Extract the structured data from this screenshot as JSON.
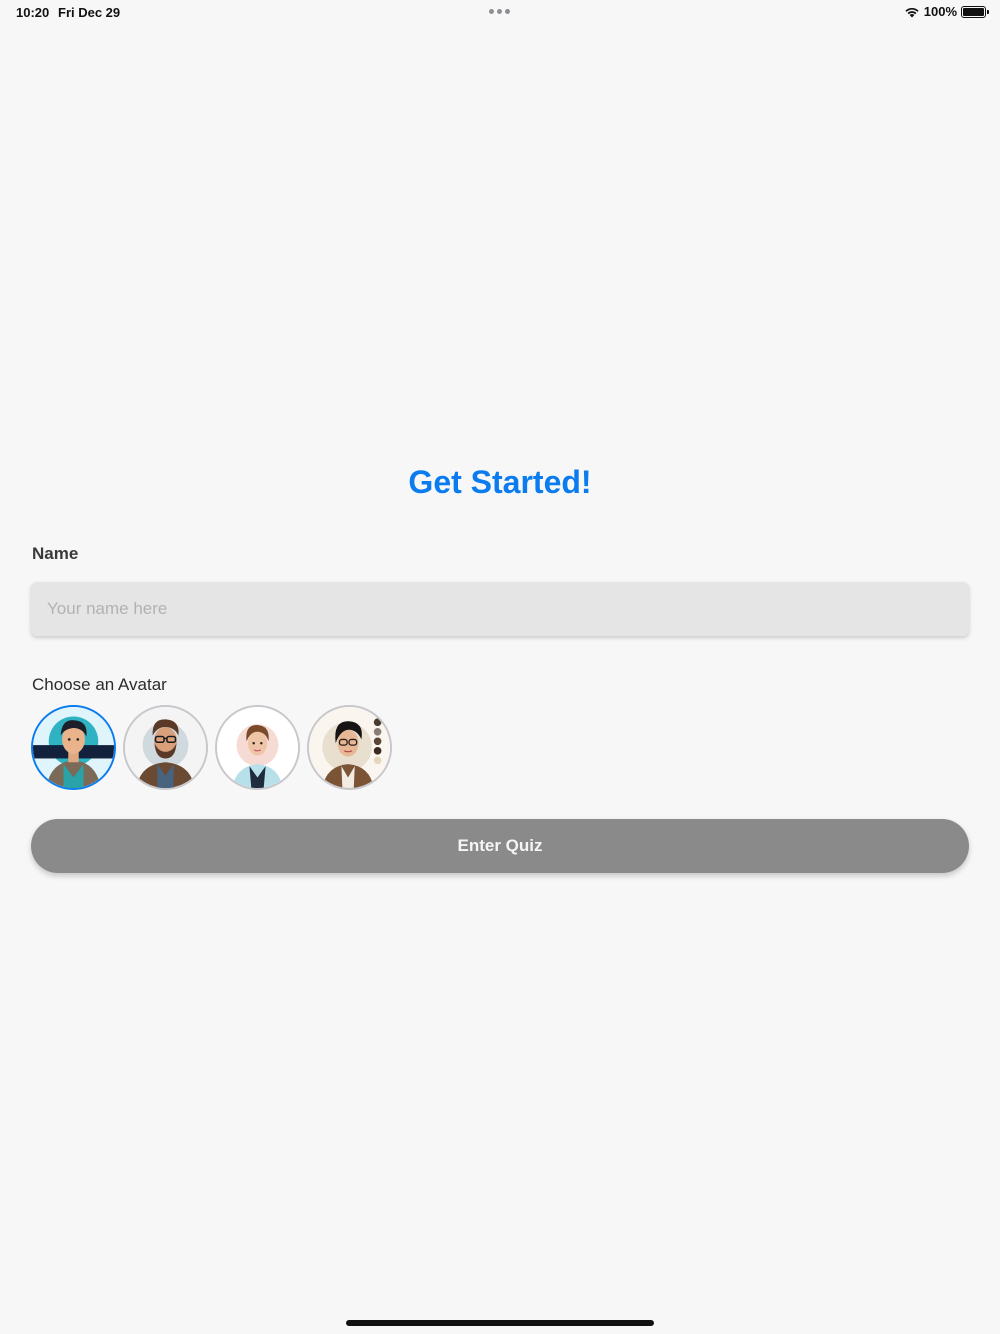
{
  "status_bar": {
    "time": "10:20",
    "date": "Fri Dec 29",
    "battery_percent": "100%",
    "icons": [
      "wifi-icon",
      "battery-icon"
    ]
  },
  "main": {
    "title": "Get Started!",
    "name_label": "Name",
    "name_input": {
      "value": "",
      "placeholder": "Your name here"
    },
    "avatar_label": "Choose an Avatar",
    "avatars": [
      {
        "name": "avatar-man-teal-shirt",
        "selected": true
      },
      {
        "name": "avatar-man-glasses-beard",
        "selected": false
      },
      {
        "name": "avatar-woman-short-hair",
        "selected": false
      },
      {
        "name": "avatar-woman-glasses",
        "selected": false
      }
    ],
    "enter_button": "Enter Quiz"
  },
  "colors": {
    "accent": "#0a7cf0",
    "background": "#f7f7f7",
    "input_bg": "#e5e5e5",
    "button_disabled": "#8a8a8a"
  }
}
